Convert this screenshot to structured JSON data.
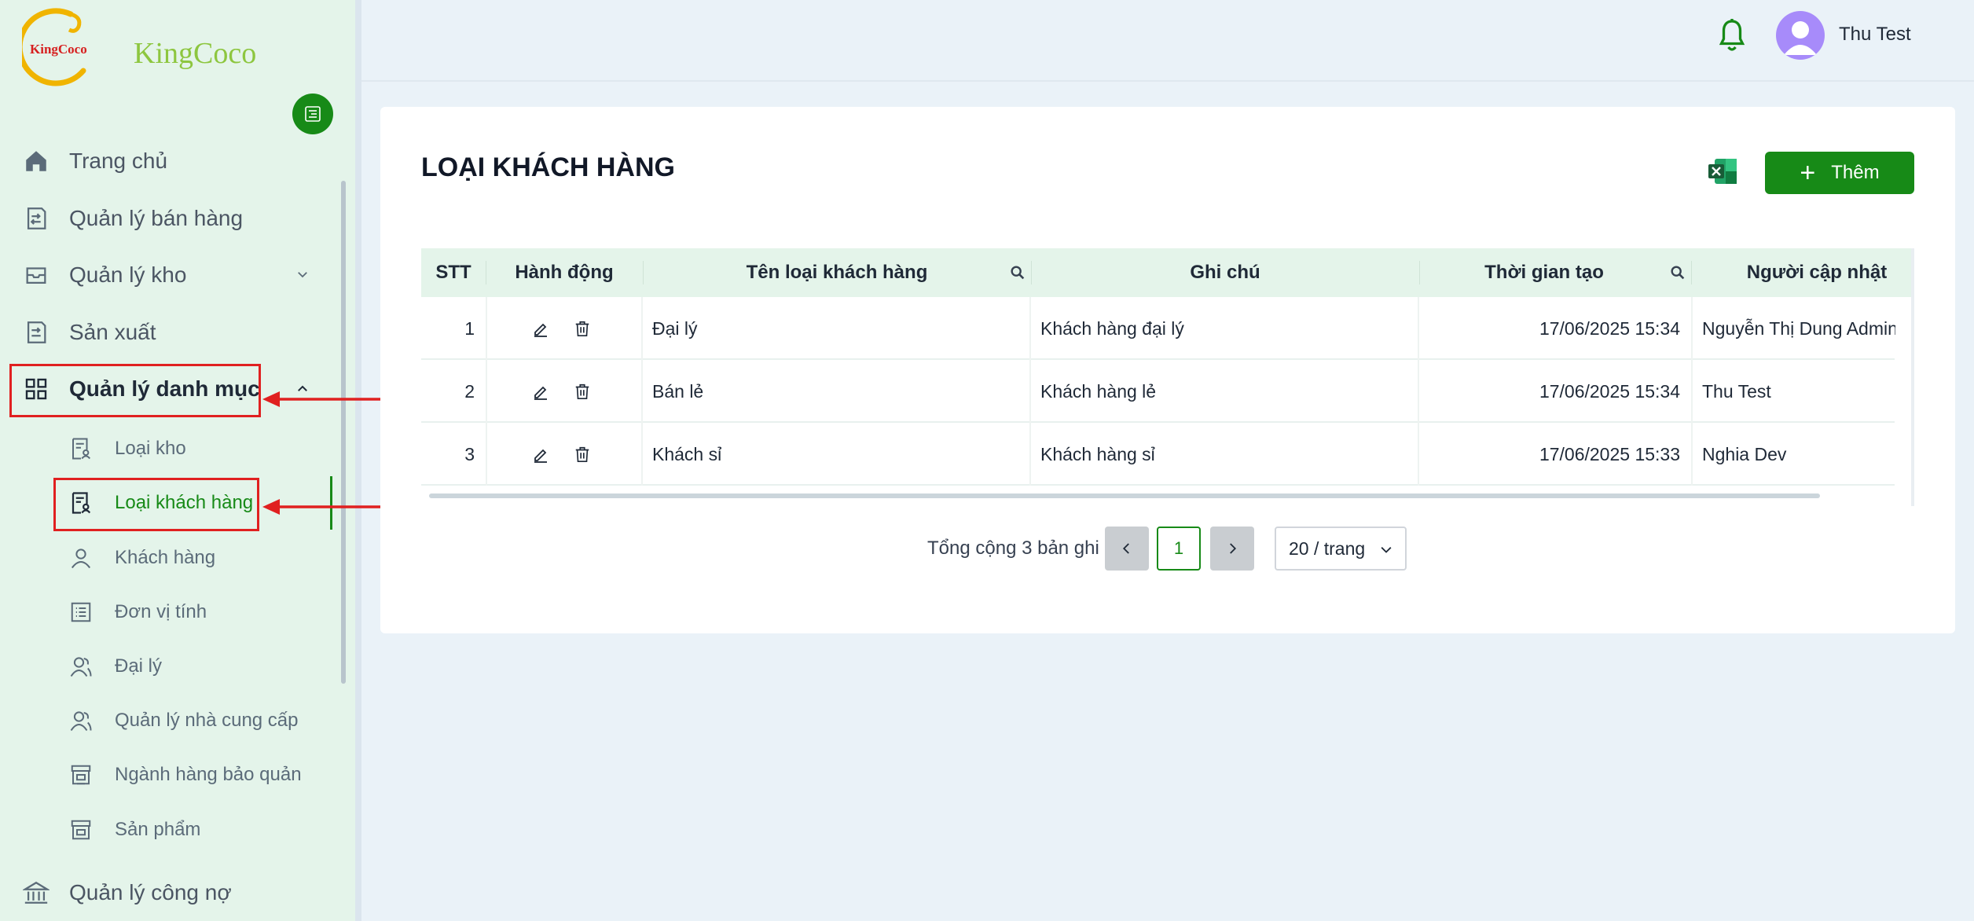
{
  "app": {
    "logo_text": "KingCoco",
    "logo_mark": "KingCoco"
  },
  "header": {
    "username": "Thu Test"
  },
  "sidebar": {
    "items": [
      {
        "label": "Trang chủ",
        "icon": "home-icon"
      },
      {
        "label": "Quản lý bán hàng",
        "icon": "sales-icon"
      },
      {
        "label": "Quản lý kho",
        "icon": "inbox-icon"
      },
      {
        "label": "Sản xuất",
        "icon": "production-icon"
      },
      {
        "label": "Quản lý danh mục",
        "icon": "grid-icon"
      },
      {
        "label": "Quản lý công nợ",
        "icon": "bank-icon"
      }
    ],
    "sub_items": [
      {
        "label": "Loại kho",
        "icon": "doc-user-icon"
      },
      {
        "label": "Loại khách hàng",
        "icon": "doc-user-icon"
      },
      {
        "label": "Khách hàng",
        "icon": "user-icon"
      },
      {
        "label": "Đơn vị tính",
        "icon": "list-icon"
      },
      {
        "label": "Đại lý",
        "icon": "users-icon"
      },
      {
        "label": "Quản lý nhà cung cấp",
        "icon": "users-icon"
      },
      {
        "label": "Ngành hàng bảo quản",
        "icon": "store-icon"
      },
      {
        "label": "Sản phẩm",
        "icon": "store-icon"
      }
    ]
  },
  "page": {
    "title": "LOẠI KHÁCH HÀNG",
    "add_label": "Thêm"
  },
  "table": {
    "columns": [
      "STT",
      "Hành động",
      "Tên loại khách hàng",
      "Ghi chú",
      "Thời gian tạo",
      "Người cập nhật"
    ],
    "rows": [
      {
        "stt": "1",
        "name": "Đại lý",
        "note": "Khách hàng đại lý",
        "created": "17/06/2025 15:34",
        "updated_by": "Nguyễn Thị Dung Admin"
      },
      {
        "stt": "2",
        "name": "Bán lẻ",
        "note": "Khách hàng lẻ",
        "created": "17/06/2025 15:34",
        "updated_by": "Thu Test"
      },
      {
        "stt": "3",
        "name": "Khách sỉ",
        "note": "Khách hàng sỉ",
        "created": "17/06/2025 15:33",
        "updated_by": "Nghia Dev"
      }
    ]
  },
  "pagination": {
    "total_text": "Tổng cộng 3 bản ghi",
    "current_page": "1",
    "page_size": "20 / trang"
  },
  "colors": {
    "primary": "#178a17",
    "sidebar_bg": "#e4f4ea",
    "annotation": "#e02020"
  }
}
